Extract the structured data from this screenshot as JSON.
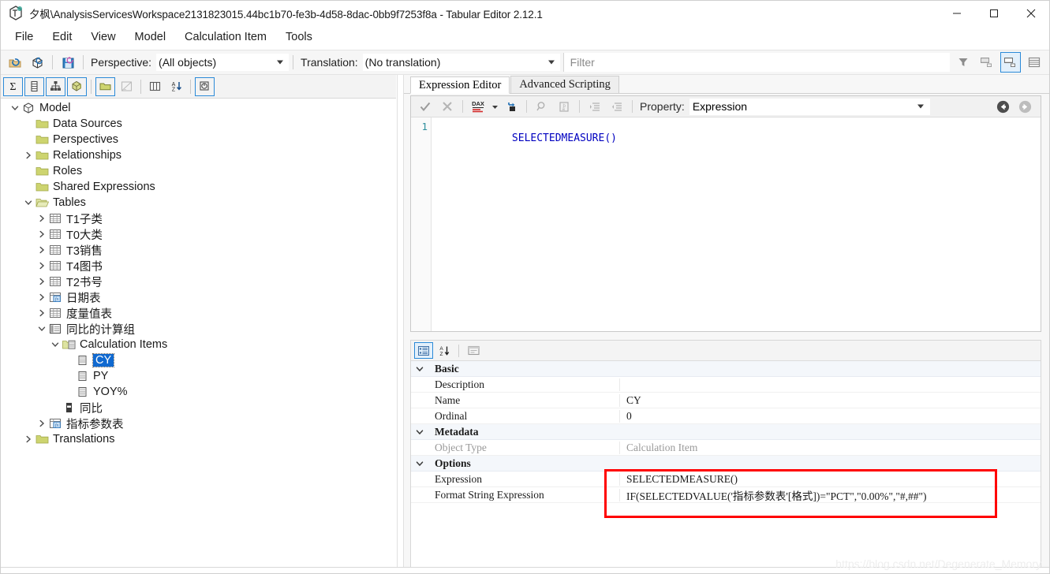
{
  "window": {
    "title": "夕枫\\AnalysisServicesWorkspace2131823015.44bc1b70-fe3b-4d58-8dac-0bb9f7253f8a - Tabular Editor 2.12.1",
    "app_icon": "tabular-editor-icon",
    "minimize": "—",
    "maximize": "▢",
    "close": "✕"
  },
  "menubar": {
    "items": [
      {
        "label": "File"
      },
      {
        "label": "Edit"
      },
      {
        "label": "View"
      },
      {
        "label": "Model"
      },
      {
        "label": "Calculation Item"
      },
      {
        "label": "Tools"
      }
    ]
  },
  "toolbar_main": {
    "open_icon": "open-folder-icon",
    "refresh_icon": "refresh-model-icon",
    "save_icon": "save-icon",
    "perspective_label": "Perspective:",
    "perspective_value": "(All objects)",
    "translation_label": "Translation:",
    "translation_value": "(No translation)",
    "filter_placeholder": "Filter",
    "filter_value": "",
    "right_icons": [
      {
        "name": "filter-funnel-icon",
        "selected": false
      },
      {
        "name": "show-hidden-objects-icon",
        "selected": false
      },
      {
        "name": "show-display-folders-icon",
        "selected": true
      },
      {
        "name": "show-all-columns-icon",
        "selected": false
      }
    ]
  },
  "toolbar_secondary": {
    "buttons": [
      {
        "name": "new-measure-icon",
        "glyph": "Σ",
        "boxed": true
      },
      {
        "name": "new-column-icon",
        "glyph": "▤",
        "boxed": true
      },
      {
        "name": "new-hierarchy-icon",
        "glyph": "▲",
        "boxed": true
      },
      {
        "name": "new-calculation-group-icon",
        "glyph": "◈",
        "boxed": true
      },
      {
        "name": "new-table-icon",
        "glyph": "▱",
        "boxed": true
      },
      {
        "name": "new-calculated-table-icon",
        "glyph": "◺",
        "boxed": false
      },
      {
        "name": "columns-view-icon",
        "glyph": "▥",
        "boxed": false
      },
      {
        "name": "sort-az-icon",
        "glyph": "A↓",
        "boxed": false
      },
      {
        "name": "best-practice-analyzer-icon",
        "glyph": "◎",
        "boxed": true
      }
    ]
  },
  "tree": {
    "nodes": [
      {
        "id": "model",
        "depth": 0,
        "expander": "expanded",
        "icon": "model-cube-icon",
        "label": "Model",
        "selected": false
      },
      {
        "id": "data-sources",
        "depth": 1,
        "expander": "none",
        "icon": "folder-icon",
        "label": "Data Sources",
        "selected": false
      },
      {
        "id": "perspectives",
        "depth": 1,
        "expander": "none",
        "icon": "folder-icon",
        "label": "Perspectives",
        "selected": false
      },
      {
        "id": "relationships",
        "depth": 1,
        "expander": "collapsed",
        "icon": "folder-icon",
        "label": "Relationships",
        "selected": false
      },
      {
        "id": "roles",
        "depth": 1,
        "expander": "none",
        "icon": "folder-icon",
        "label": "Roles",
        "selected": false
      },
      {
        "id": "shared-expressions",
        "depth": 1,
        "expander": "none",
        "icon": "folder-icon",
        "label": "Shared Expressions",
        "selected": false
      },
      {
        "id": "tables",
        "depth": 1,
        "expander": "expanded",
        "icon": "open-folder-icon",
        "label": "Tables",
        "selected": false
      },
      {
        "id": "t1zilei",
        "depth": 2,
        "expander": "collapsed",
        "icon": "table-icon",
        "label": "T1子类",
        "selected": false
      },
      {
        "id": "t0dalei",
        "depth": 2,
        "expander": "collapsed",
        "icon": "table-icon",
        "label": "T0大类",
        "selected": false
      },
      {
        "id": "t3xiaoshou",
        "depth": 2,
        "expander": "collapsed",
        "icon": "table-icon",
        "label": "T3销售",
        "selected": false
      },
      {
        "id": "t4tushu",
        "depth": 2,
        "expander": "collapsed",
        "icon": "table-icon",
        "label": "T4图书",
        "selected": false
      },
      {
        "id": "t2shuhao",
        "depth": 2,
        "expander": "collapsed",
        "icon": "table-icon",
        "label": "T2书号",
        "selected": false
      },
      {
        "id": "riqibiao",
        "depth": 2,
        "expander": "collapsed",
        "icon": "calculated-table-icon",
        "label": "日期表",
        "selected": false
      },
      {
        "id": "duliangzhibiao",
        "depth": 2,
        "expander": "collapsed",
        "icon": "table-icon",
        "label": "度量值表",
        "selected": false
      },
      {
        "id": "tongbi-calc-group",
        "depth": 2,
        "expander": "expanded",
        "icon": "calculation-group-icon",
        "label": "同比的计算组",
        "selected": false
      },
      {
        "id": "calculation-items",
        "depth": 3,
        "expander": "expanded",
        "icon": "calc-items-folder-icon",
        "label": "Calculation Items",
        "selected": false
      },
      {
        "id": "ci-cy",
        "depth": 4,
        "expander": "none",
        "icon": "calculation-item-icon",
        "label": "CY",
        "selected": true
      },
      {
        "id": "ci-py",
        "depth": 4,
        "expander": "none",
        "icon": "calculation-item-icon",
        "label": "PY",
        "selected": false
      },
      {
        "id": "ci-yoy",
        "depth": 4,
        "expander": "none",
        "icon": "calculation-item-icon",
        "label": "YOY%",
        "selected": false
      },
      {
        "id": "col-tongbi",
        "depth": 3,
        "expander": "none",
        "icon": "column-icon",
        "label": "同比",
        "selected": false
      },
      {
        "id": "zhibiaocanshu",
        "depth": 2,
        "expander": "collapsed",
        "icon": "calculated-table-icon",
        "label": "指标参数表",
        "selected": false
      },
      {
        "id": "translations",
        "depth": 1,
        "expander": "collapsed",
        "icon": "folder-icon",
        "label": "Translations",
        "selected": false
      }
    ]
  },
  "editor_panel": {
    "tabs": [
      {
        "id": "expression-editor",
        "label": "Expression Editor",
        "active": true
      },
      {
        "id": "advanced-scripting",
        "label": "Advanced Scripting",
        "active": false
      }
    ],
    "toolbar": {
      "accept": "accept-check-icon",
      "cancel": "cancel-x-icon",
      "dax_format": "dax-format-icon",
      "dax_dropdown": "dax-format-dropdown-icon",
      "replace": "replace-icon",
      "find": "find-magnifier-icon",
      "goto": "goto-definition-icon",
      "indent": "increase-indent-icon",
      "outdent": "decrease-indent-icon",
      "property_label": "Property:",
      "property_value": "Expression",
      "nav_back": "navigate-back-icon",
      "nav_forward": "navigate-forward-icon"
    },
    "code": {
      "line_numbers": [
        "1"
      ],
      "lines": [
        "SELECTEDMEASURE()"
      ]
    }
  },
  "property_grid": {
    "toolbar": {
      "categorized": "categorized-view-icon",
      "alphabetical": "alphabetical-sort-icon",
      "property_pages": "property-pages-icon"
    },
    "rows": [
      {
        "type": "category",
        "name": "Basic",
        "value": "",
        "dim": false
      },
      {
        "type": "prop",
        "name": "Description",
        "value": "",
        "dim": false
      },
      {
        "type": "prop",
        "name": "Name",
        "value": "CY",
        "dim": false
      },
      {
        "type": "prop",
        "name": "Ordinal",
        "value": "0",
        "dim": false
      },
      {
        "type": "category",
        "name": "Metadata",
        "value": "",
        "dim": false
      },
      {
        "type": "prop",
        "name": "Object Type",
        "value": "Calculation Item",
        "dim": true
      },
      {
        "type": "category",
        "name": "Options",
        "value": "",
        "dim": false
      },
      {
        "type": "prop",
        "name": "Expression",
        "value": "SELECTEDMEASURE()",
        "dim": false
      },
      {
        "type": "prop",
        "name": "Format String Expression",
        "value": "IF(SELECTEDVALUE('指标参数表'[格式])=\"PCT\",\"0.00%\",\"#,##\")",
        "dim": false
      }
    ],
    "highlight_color": "#ff0000"
  },
  "watermark": "https://blog.csdn.net/Degenerate_Memory"
}
